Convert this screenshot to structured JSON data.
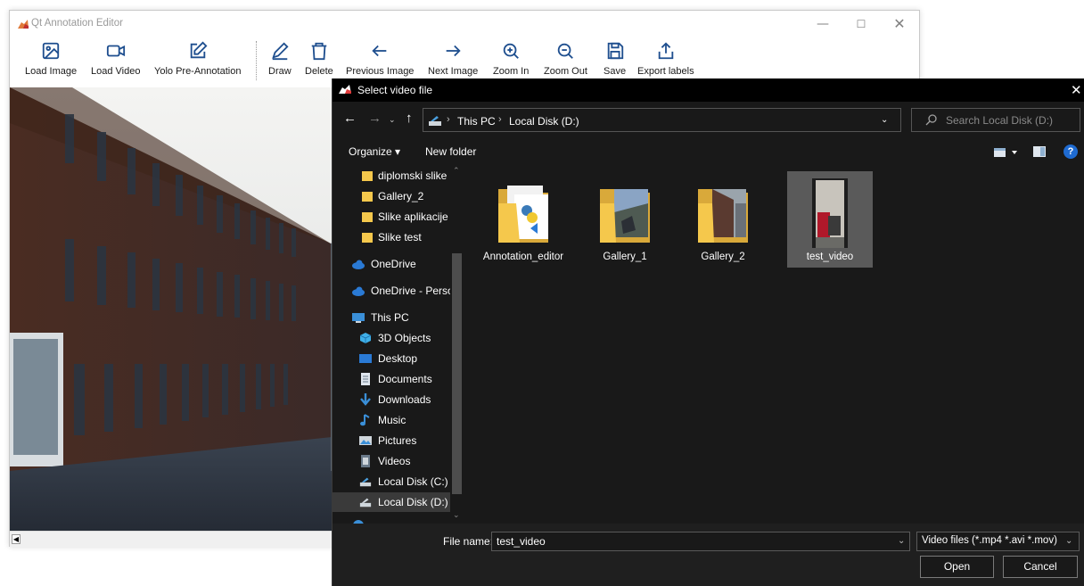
{
  "main_window": {
    "title": "Qt Annotation Editor",
    "controls": {
      "minimize": "—",
      "maximize": "☐",
      "close": "✕"
    }
  },
  "toolbar": {
    "buttons": [
      {
        "label": "Load Image",
        "icon": "image-icon"
      },
      {
        "label": "Load Video",
        "icon": "video-camera-icon"
      },
      {
        "label": "Yolo Pre-Annotation",
        "icon": "edit-square-icon"
      },
      {
        "label": "Draw",
        "icon": "pencil-icon"
      },
      {
        "label": "Delete",
        "icon": "trash-icon"
      },
      {
        "label": "Previous Image",
        "icon": "arrow-left-icon"
      },
      {
        "label": "Next Image",
        "icon": "arrow-right-icon"
      },
      {
        "label": "Zoom In",
        "icon": "zoom-in-icon"
      },
      {
        "label": "Zoom Out",
        "icon": "zoom-out-icon"
      },
      {
        "label": "Save",
        "icon": "save-icon"
      },
      {
        "label": "Export labels",
        "icon": "export-icon"
      }
    ]
  },
  "dialog": {
    "title": "Select video file",
    "close": "✕",
    "nav": {
      "back": "←",
      "forward": "→",
      "recent": "⌄",
      "up": "↑",
      "refresh": "↻",
      "dropdown": "⌄"
    },
    "breadcrumb": {
      "sep1": "›",
      "this_pc": "This PC",
      "sep2": "›",
      "disk": "Local Disk (D:)"
    },
    "search": {
      "placeholder": "Search Local Disk (D:)"
    },
    "commands": {
      "organize": "Organize ▾",
      "new_folder": "New folder",
      "help": "?"
    },
    "nav_pane": [
      {
        "label": "diplomski slike",
        "icon": "folder-icon"
      },
      {
        "label": "Gallery_2",
        "icon": "folder-icon"
      },
      {
        "label": "Slike aplikacije",
        "icon": "folder-icon"
      },
      {
        "label": "Slike test",
        "icon": "folder-icon"
      },
      {
        "label": "OneDrive",
        "icon": "cloud-icon"
      },
      {
        "label": "OneDrive - Persor",
        "icon": "cloud-icon"
      },
      {
        "label": "This PC",
        "icon": "computer-icon"
      },
      {
        "label": "3D Objects",
        "icon": "cube-icon"
      },
      {
        "label": "Desktop",
        "icon": "desktop-icon"
      },
      {
        "label": "Documents",
        "icon": "document-icon"
      },
      {
        "label": "Downloads",
        "icon": "download-icon"
      },
      {
        "label": "Music",
        "icon": "music-note-icon"
      },
      {
        "label": "Pictures",
        "icon": "pictures-icon"
      },
      {
        "label": "Videos",
        "icon": "video-icon"
      },
      {
        "label": "Local Disk (C:)",
        "icon": "drive-icon"
      },
      {
        "label": "Local Disk (D:)",
        "icon": "drive-icon",
        "selected": true
      }
    ],
    "scroll": {
      "up": "⌃",
      "down": "⌄"
    },
    "files": [
      {
        "label": "Annotation_editor",
        "type": "folder"
      },
      {
        "label": "Gallery_1",
        "type": "folder"
      },
      {
        "label": "Gallery_2",
        "type": "folder"
      },
      {
        "label": "test_video",
        "type": "video",
        "selected": true
      }
    ],
    "file_name_label": "File name:",
    "file_name_value": "test_video",
    "filter_value": "Video files (*.mp4 *.avi *.mov)",
    "dropdown_arrow": "⌄",
    "open_label": "Open",
    "cancel_label": "Cancel"
  },
  "colors": {
    "dialog_bg": "#191919",
    "titlebar_bg": "#000000",
    "folder_yellow": "#f5c84c",
    "selection": "#5a5a5a",
    "accent_blue": "#1f6bd1"
  }
}
